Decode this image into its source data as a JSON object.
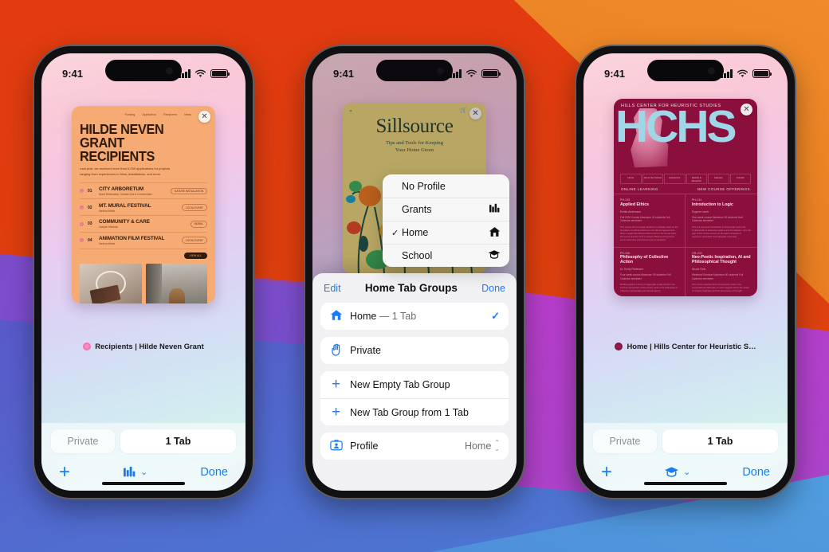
{
  "background": {
    "top_color": "#e23b10",
    "wedge_color": "#ef8b2a",
    "bottom_color": "#5a57c9",
    "magenta_color": "#c43fd4",
    "cyan_color": "#49a8de"
  },
  "status_bar": {
    "time": "9:41",
    "signal_icon": "cellular-bars-icon",
    "wifi_icon": "wifi-icon",
    "battery_icon": "battery-icon"
  },
  "phones": [
    {
      "id": "phone-left",
      "tab_title": "Recipients | Hilde Neven Grant",
      "close_label": "✕",
      "card": {
        "type": "grant-site",
        "nav": [
          "Funding",
          "Application",
          "Recipients",
          "News"
        ],
        "heading_line1": "HILDE NEVEN",
        "heading_line2": "GRANT RECIPIENTS",
        "intro": "Last year, we received more than 6,000 applications for projects ranging from experiences to films, installations, and more.",
        "rows": [
          {
            "num": "01",
            "name": "CITY ARBORETUM",
            "sub": "Mural Restoration, Outside Arts & Conservation",
            "tag": "NATURE INSTALLATION"
          },
          {
            "num": "02",
            "name": "MT. MURAL FESTIVAL",
            "sub": "Various Artists",
            "tag": "LOCAL EVENT"
          },
          {
            "num": "03",
            "name": "COMMUNITY & CARE",
            "sub": "Joaquin Miranda",
            "tag": "MURAL"
          },
          {
            "num": "04",
            "name": "ANIMATION FILM FESTIVAL",
            "sub": "Various Artists",
            "tag": "LOCAL EVENT"
          }
        ],
        "view_all": "VIEW ALL"
      },
      "bottom_bar": {
        "private_label": "Private",
        "tabs_label": "1 Tab",
        "new_tab_icon": "plus-icon",
        "group_icon": "books-library-icon",
        "chevron_icon": "chevron-down-icon",
        "done_label": "Done"
      }
    },
    {
      "id": "phone-center",
      "close_label": "✕",
      "card": {
        "type": "sillsource",
        "title": "Sillsource",
        "subtitle_line1": "Tips and Tools for Keeping",
        "subtitle_line2": "Your Home Green"
      },
      "sheet": {
        "edit_label": "Edit",
        "title": "Home Tab Groups",
        "done_label": "Done",
        "rows": [
          {
            "name": "tab-group-home",
            "icon": "house-icon",
            "label": "Home",
            "detail": "— 1 Tab",
            "check": "✓"
          },
          {
            "name": "tab-group-private",
            "icon": "hand-raised-icon",
            "label": "Private",
            "detail": "",
            "check": ""
          },
          {
            "name": "new-empty-tab-group",
            "icon": "plus-icon",
            "label": "New Empty Tab Group",
            "detail": "",
            "check": ""
          },
          {
            "name": "new-tab-group-from-tabs",
            "icon": "plus-icon",
            "label": "New Tab Group from 1 Tab",
            "detail": "",
            "check": ""
          },
          {
            "name": "profile-row",
            "icon": "profile-card-icon",
            "label": "Profile",
            "detail": "Home",
            "check": ""
          }
        ]
      },
      "popover": {
        "items": [
          {
            "label": "No Profile",
            "icon": "",
            "selected": false
          },
          {
            "label": "Grants",
            "icon": "books-library-icon",
            "icon_glyph": "📊",
            "selected": false
          },
          {
            "label": "Home",
            "icon": "house-icon",
            "icon_glyph": "⌂",
            "selected": true
          },
          {
            "label": "School",
            "icon": "graduation-cap-icon",
            "icon_glyph": "🎓",
            "selected": false
          }
        ],
        "check_glyph": "✓"
      }
    },
    {
      "id": "phone-right",
      "tab_title": "Home | Hills Center for Heuristic S…",
      "close_label": "✕",
      "card": {
        "type": "hchs-site",
        "top_banner": "HILLS CENTER FOR HEURISTIC STUDIES",
        "wordmark": "HCHS",
        "nav": [
          "Home",
          "About the School",
          "Academics",
          "Faculty & Research",
          "Campus",
          "Contact"
        ],
        "section_left": "ONLINE LEARNING",
        "section_right": "NEW COURSE OFFERINGS",
        "courses": [
          {
            "code": "PH-315",
            "title": "Applied Ethics",
            "who": "Emilia Andersson",
            "meta": "Fall 2024 Course\nMaximum 40 students\nFull Calendar semester",
            "body": "This course will encourage students to evaluate cases on the foundation of ethical problems in the law and government. When a legal and ethical conflict occurs in the formal realm, this course teaches how to analyze different perspectives and to determine practical avenues to resolution."
          },
          {
            "code": "PH-144",
            "title": "Introduction to Logic",
            "who": "Eugene Lamb",
            "meta": "One-week course\nMaximum 30 students\nHalf Calendar semester",
            "body": "This is a one-week introduction to formal logic and to the fundamentals of deductive systems and the fallacies. Here the plan of this course centers on the basic principles of argument, proposition and syllogistic reasoning."
          },
          {
            "code": "PH-205",
            "title": "Philosophy of Collective Action",
            "who": "Dr. Emily Pedersen",
            "meta": "Four-week course\nMaximum 50 students\nFull Calendar semester",
            "body": "Building against a theory of aggregate social conduct, this seminar approaches contemporary work in the philosophy of collective intentionality and shared agency."
          },
          {
            "code": "GR-233",
            "title": "Neo-Poetic Inspiration, AI and Philosophical Thought",
            "who": "Nicole Reis",
            "meta": "Weekend Seminar\nMaximum 60 students\nFull Calendar semester",
            "body": "This course explores what contemporary work in the computational philosophy of mind suggests about the nature of creative inspiration and the provenance of thought."
          }
        ]
      },
      "bottom_bar": {
        "private_label": "Private",
        "tabs_label": "1 Tab",
        "new_tab_icon": "plus-icon",
        "group_icon": "graduation-cap-icon",
        "chevron_icon": "chevron-down-icon",
        "done_label": "Done"
      }
    }
  ]
}
